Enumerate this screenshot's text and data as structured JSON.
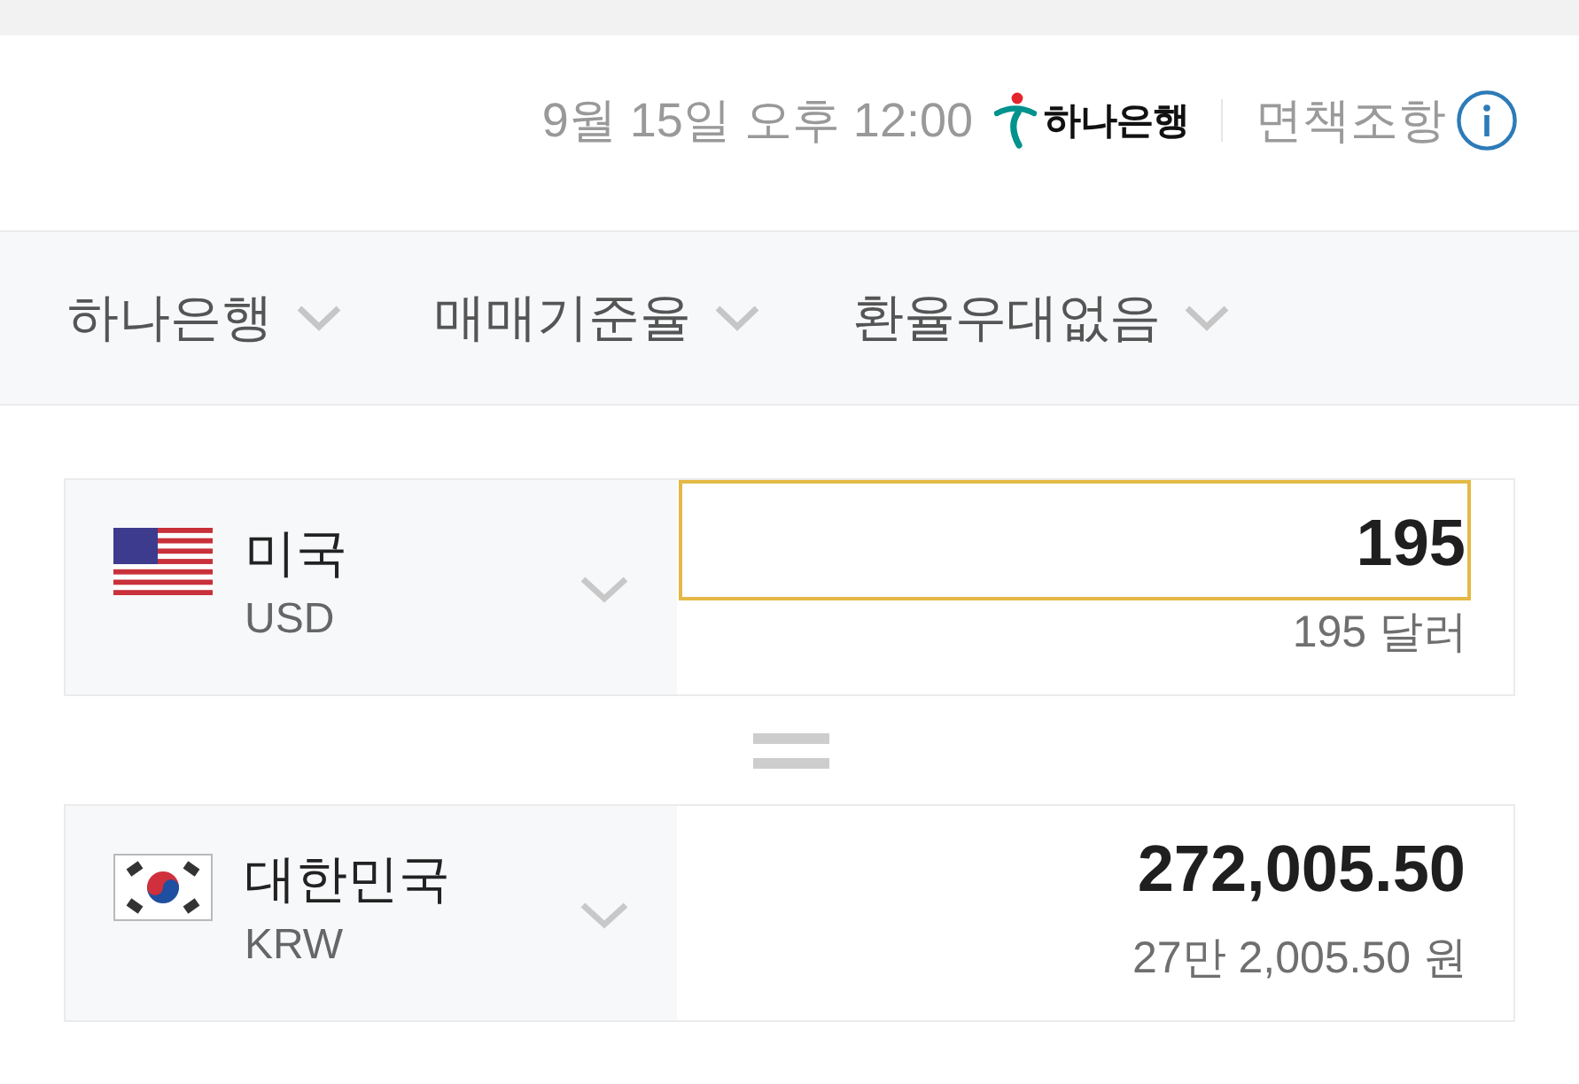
{
  "top_info": {
    "timestamp": "9월 15일 오후 12:00",
    "bank_logo_text": "하나은행",
    "disclaimer_link": "면책조항"
  },
  "filters": [
    {
      "label": "하나은행"
    },
    {
      "label": "매매기준율"
    },
    {
      "label": "환율우대없음"
    }
  ],
  "converter": [
    {
      "kind": "us",
      "country": "미국",
      "currency_code": "USD",
      "amount": "195",
      "amount_in_words": "195 달러",
      "focused": true
    },
    {
      "kind": "kr",
      "country": "대한민국",
      "currency_code": "KRW",
      "amount": "272,005.50",
      "amount_in_words": "27만 2,005.50 원",
      "focused": false
    }
  ]
}
